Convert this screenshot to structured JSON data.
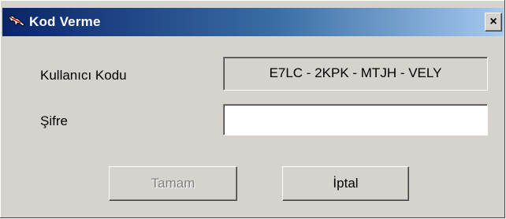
{
  "window": {
    "title": "Kod Verme",
    "close_label": "×"
  },
  "form": {
    "user_code_label": "Kullanıcı Kodu",
    "user_code_value": "E7LC - 2KPK - MTJH - VELY",
    "password_label": "Şifre",
    "password_value": ""
  },
  "buttons": {
    "ok_label": "Tamam",
    "ok_enabled": false,
    "cancel_label": "İptal"
  },
  "icons": {
    "app": "lizard-app-icon",
    "close": "close-icon"
  },
  "colors": {
    "titlebar_start": "#0a246a",
    "titlebar_end": "#a6caf0",
    "window_face": "#d6d3ce"
  }
}
